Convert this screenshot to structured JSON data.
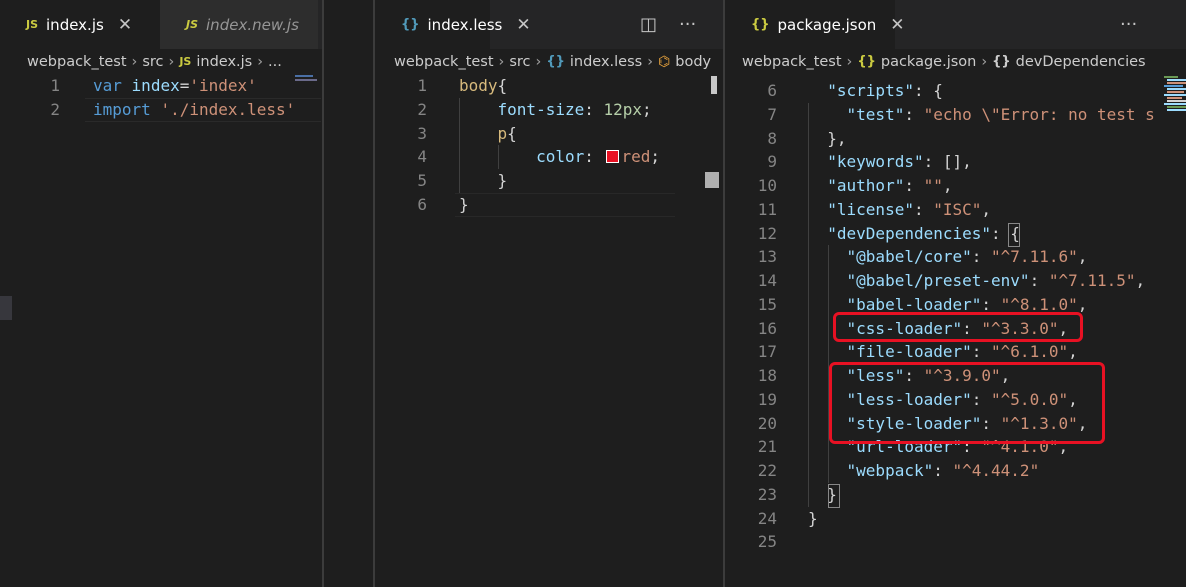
{
  "panes": [
    {
      "tabs": [
        {
          "icon": "JS",
          "label": "index.js",
          "active": true,
          "close": "✕"
        },
        {
          "icon": "JS",
          "label": "index.new.js",
          "active": false
        }
      ],
      "actions": [
        "···"
      ],
      "breadcrumb": [
        "webpack_test",
        "src",
        "index.js",
        "..."
      ],
      "lines": [
        {
          "n": "1",
          "tokens": [
            [
              "kw",
              "var"
            ],
            [
              "d",
              " "
            ],
            [
              "var",
              "index"
            ],
            [
              "d",
              "="
            ],
            [
              "str",
              "'index'"
            ]
          ]
        },
        {
          "n": "2",
          "tokens": [
            [
              "kw",
              "import"
            ],
            [
              "d",
              " "
            ],
            [
              "str",
              "'./index.less'"
            ]
          ]
        }
      ]
    },
    {
      "tabs": [
        {
          "icon": "{}",
          "label": "index.less",
          "active": true,
          "close": "✕"
        }
      ],
      "actions": [
        "◫",
        "···"
      ],
      "breadcrumb": [
        "webpack_test",
        "src",
        "index.less",
        "body"
      ],
      "lines": [
        {
          "n": "1",
          "tokens": [
            [
              "sel",
              "body"
            ],
            [
              "brace",
              "{"
            ]
          ]
        },
        {
          "n": "2",
          "tokens": [
            [
              "d",
              "    "
            ],
            [
              "prop",
              "font-size"
            ],
            [
              "d",
              ": "
            ],
            [
              "num",
              "12px"
            ],
            [
              "d",
              ";"
            ]
          ]
        },
        {
          "n": "3",
          "tokens": [
            [
              "d",
              "    "
            ],
            [
              "sel",
              "p"
            ],
            [
              "brace",
              "{"
            ]
          ]
        },
        {
          "n": "4",
          "tokens": [
            [
              "d",
              "        "
            ],
            [
              "prop",
              "color"
            ],
            [
              "d",
              ": "
            ],
            [
              "swatch",
              "#e81123"
            ],
            [
              "str",
              "red"
            ],
            [
              "d",
              ";"
            ]
          ]
        },
        {
          "n": "5",
          "tokens": [
            [
              "d",
              "    "
            ],
            [
              "brace",
              "}"
            ]
          ]
        },
        {
          "n": "6",
          "tokens": [
            [
              "brace",
              "}"
            ]
          ]
        }
      ]
    },
    {
      "tabs": [
        {
          "icon": "{}",
          "label": "package.json",
          "active": true,
          "close": "✕"
        }
      ],
      "actions": [
        "···"
      ],
      "breadcrumb": [
        "webpack_test",
        "package.json",
        "devDependencies"
      ],
      "lines": [
        {
          "n": "6",
          "tokens": [
            [
              "d",
              "  "
            ],
            [
              "prop",
              "\"scripts\""
            ],
            [
              "d",
              ": {"
            ]
          ]
        },
        {
          "n": "7",
          "tokens": [
            [
              "d",
              "    "
            ],
            [
              "prop",
              "\"test\""
            ],
            [
              "d",
              ": "
            ],
            [
              "str",
              "\"echo \\\"Error: no test s"
            ]
          ]
        },
        {
          "n": "8",
          "tokens": [
            [
              "d",
              "  },"
            ]
          ]
        },
        {
          "n": "9",
          "tokens": [
            [
              "d",
              "  "
            ],
            [
              "prop",
              "\"keywords\""
            ],
            [
              "d",
              ": [],"
            ]
          ]
        },
        {
          "n": "10",
          "tokens": [
            [
              "d",
              "  "
            ],
            [
              "prop",
              "\"author\""
            ],
            [
              "d",
              ": "
            ],
            [
              "str",
              "\"\""
            ],
            [
              "d",
              ","
            ]
          ]
        },
        {
          "n": "11",
          "tokens": [
            [
              "d",
              "  "
            ],
            [
              "prop",
              "\"license\""
            ],
            [
              "d",
              ": "
            ],
            [
              "str",
              "\"ISC\""
            ],
            [
              "d",
              ","
            ]
          ]
        },
        {
          "n": "12",
          "tokens": [
            [
              "d",
              "  "
            ],
            [
              "prop",
              "\"devDependencies\""
            ],
            [
              "d",
              ": {"
            ]
          ]
        },
        {
          "n": "13",
          "tokens": [
            [
              "d",
              "    "
            ],
            [
              "prop",
              "\"@babel/core\""
            ],
            [
              "d",
              ": "
            ],
            [
              "str",
              "\"^7.11.6\""
            ],
            [
              "d",
              ","
            ]
          ]
        },
        {
          "n": "14",
          "tokens": [
            [
              "d",
              "    "
            ],
            [
              "prop",
              "\"@babel/preset-env\""
            ],
            [
              "d",
              ": "
            ],
            [
              "str",
              "\"^7.11.5\""
            ],
            [
              "d",
              ","
            ]
          ]
        },
        {
          "n": "15",
          "tokens": [
            [
              "d",
              "    "
            ],
            [
              "prop",
              "\"babel-loader\""
            ],
            [
              "d",
              ": "
            ],
            [
              "str",
              "\"^8.1.0\""
            ],
            [
              "d",
              ","
            ]
          ]
        },
        {
          "n": "16",
          "tokens": [
            [
              "d",
              "    "
            ],
            [
              "prop",
              "\"css-loader\""
            ],
            [
              "d",
              ": "
            ],
            [
              "str",
              "\"^3.3.0\""
            ],
            [
              "d",
              ","
            ]
          ]
        },
        {
          "n": "17",
          "tokens": [
            [
              "d",
              "    "
            ],
            [
              "prop",
              "\"file-loader\""
            ],
            [
              "d",
              ": "
            ],
            [
              "str",
              "\"^6.1.0\""
            ],
            [
              "d",
              ","
            ]
          ]
        },
        {
          "n": "18",
          "tokens": [
            [
              "d",
              "    "
            ],
            [
              "prop",
              "\"less\""
            ],
            [
              "d",
              ": "
            ],
            [
              "str",
              "\"^3.9.0\""
            ],
            [
              "d",
              ","
            ]
          ]
        },
        {
          "n": "19",
          "tokens": [
            [
              "d",
              "    "
            ],
            [
              "prop",
              "\"less-loader\""
            ],
            [
              "d",
              ": "
            ],
            [
              "str",
              "\"^5.0.0\""
            ],
            [
              "d",
              ","
            ]
          ]
        },
        {
          "n": "20",
          "tokens": [
            [
              "d",
              "    "
            ],
            [
              "prop",
              "\"style-loader\""
            ],
            [
              "d",
              ": "
            ],
            [
              "str",
              "\"^1.3.0\""
            ],
            [
              "d",
              ","
            ]
          ]
        },
        {
          "n": "21",
          "tokens": [
            [
              "d",
              "    "
            ],
            [
              "prop",
              "\"url-loader\""
            ],
            [
              "d",
              ": "
            ],
            [
              "str",
              "\"^4.1.0\""
            ],
            [
              "d",
              ","
            ]
          ]
        },
        {
          "n": "22",
          "tokens": [
            [
              "d",
              "    "
            ],
            [
              "prop",
              "\"webpack\""
            ],
            [
              "d",
              ": "
            ],
            [
              "str",
              "\"^4.44.2\""
            ]
          ]
        },
        {
          "n": "23",
          "tokens": [
            [
              "d",
              "  }"
            ]
          ]
        },
        {
          "n": "24",
          "tokens": [
            [
              "d",
              "}"
            ]
          ]
        },
        {
          "n": "25",
          "tokens": []
        }
      ]
    }
  ],
  "colors": {
    "editor_bg": "#1e1e1e",
    "tabbar_bg": "#252526",
    "highlight_box": "#e81123"
  }
}
